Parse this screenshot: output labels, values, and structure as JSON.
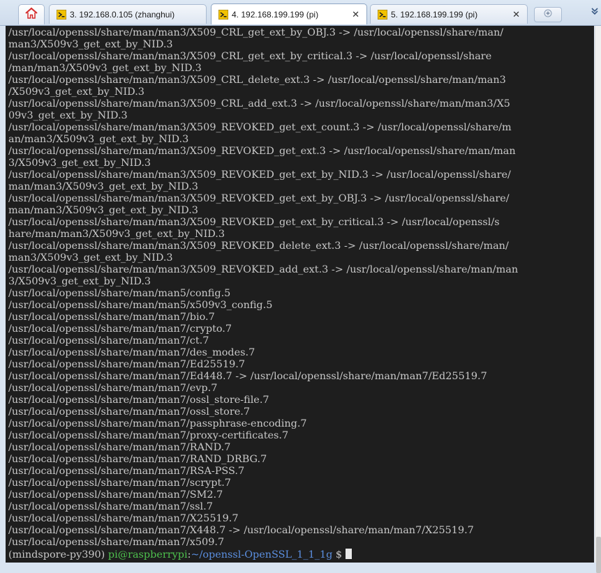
{
  "tabs": [
    {
      "label": "3. 192.168.0.105 (zhanghui)",
      "icon": "terminal-key-icon"
    },
    {
      "label": "4. 192.168.199.199 (pi)",
      "icon": "terminal-key-icon",
      "close": "✕"
    },
    {
      "label": "5. 192.168.199.199 (pi)",
      "icon": "terminal-key-icon",
      "close": "✕"
    }
  ],
  "home_icon": "home-icon",
  "new_tab_icon": "new-tab-icon",
  "terminal": {
    "lines": [
      "/usr/local/openssl/share/man/man3/X509_CRL_get_ext_by_OBJ.3 -> /usr/local/openssl/share/man/",
      "man3/X509v3_get_ext_by_NID.3",
      "/usr/local/openssl/share/man/man3/X509_CRL_get_ext_by_critical.3 -> /usr/local/openssl/share",
      "/man/man3/X509v3_get_ext_by_NID.3",
      "/usr/local/openssl/share/man/man3/X509_CRL_delete_ext.3 -> /usr/local/openssl/share/man/man3",
      "/X509v3_get_ext_by_NID.3",
      "/usr/local/openssl/share/man/man3/X509_CRL_add_ext.3 -> /usr/local/openssl/share/man/man3/X5",
      "09v3_get_ext_by_NID.3",
      "/usr/local/openssl/share/man/man3/X509_REVOKED_get_ext_count.3 -> /usr/local/openssl/share/m",
      "an/man3/X509v3_get_ext_by_NID.3",
      "/usr/local/openssl/share/man/man3/X509_REVOKED_get_ext.3 -> /usr/local/openssl/share/man/man",
      "3/X509v3_get_ext_by_NID.3",
      "/usr/local/openssl/share/man/man3/X509_REVOKED_get_ext_by_NID.3 -> /usr/local/openssl/share/",
      "man/man3/X509v3_get_ext_by_NID.3",
      "/usr/local/openssl/share/man/man3/X509_REVOKED_get_ext_by_OBJ.3 -> /usr/local/openssl/share/",
      "man/man3/X509v3_get_ext_by_NID.3",
      "/usr/local/openssl/share/man/man3/X509_REVOKED_get_ext_by_critical.3 -> /usr/local/openssl/s",
      "hare/man/man3/X509v3_get_ext_by_NID.3",
      "/usr/local/openssl/share/man/man3/X509_REVOKED_delete_ext.3 -> /usr/local/openssl/share/man/",
      "man3/X509v3_get_ext_by_NID.3",
      "/usr/local/openssl/share/man/man3/X509_REVOKED_add_ext.3 -> /usr/local/openssl/share/man/man",
      "3/X509v3_get_ext_by_NID.3",
      "/usr/local/openssl/share/man/man5/config.5",
      "/usr/local/openssl/share/man/man5/x509v3_config.5",
      "/usr/local/openssl/share/man/man7/bio.7",
      "/usr/local/openssl/share/man/man7/crypto.7",
      "/usr/local/openssl/share/man/man7/ct.7",
      "/usr/local/openssl/share/man/man7/des_modes.7",
      "/usr/local/openssl/share/man/man7/Ed25519.7",
      "/usr/local/openssl/share/man/man7/Ed448.7 -> /usr/local/openssl/share/man/man7/Ed25519.7",
      "/usr/local/openssl/share/man/man7/evp.7",
      "/usr/local/openssl/share/man/man7/ossl_store-file.7",
      "/usr/local/openssl/share/man/man7/ossl_store.7",
      "/usr/local/openssl/share/man/man7/passphrase-encoding.7",
      "/usr/local/openssl/share/man/man7/proxy-certificates.7",
      "/usr/local/openssl/share/man/man7/RAND.7",
      "/usr/local/openssl/share/man/man7/RAND_DRBG.7",
      "/usr/local/openssl/share/man/man7/RSA-PSS.7",
      "/usr/local/openssl/share/man/man7/scrypt.7",
      "/usr/local/openssl/share/man/man7/SM2.7",
      "/usr/local/openssl/share/man/man7/ssl.7",
      "/usr/local/openssl/share/man/man7/X25519.7",
      "/usr/local/openssl/share/man/man7/X448.7 -> /usr/local/openssl/share/man/man7/X25519.7",
      "/usr/local/openssl/share/man/man7/x509.7"
    ],
    "prompt": {
      "env": "(mindspore-py390) ",
      "user_host": "pi@raspberrypi",
      "colon": ":",
      "path": "~/openssl-OpenSSL_1_1_1g",
      "dollar": " $ "
    }
  },
  "colors": {
    "terminal_bg": "#1e1e1e",
    "terminal_fg": "#c8c8c8",
    "prompt_user": "#4ec24e",
    "prompt_path": "#5b8fe0"
  }
}
